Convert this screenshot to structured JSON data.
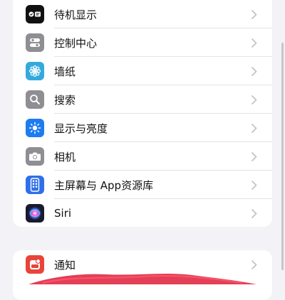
{
  "groups": [
    {
      "items": [
        {
          "label": "待机显示",
          "icon": "standby-icon",
          "color": "#111111"
        },
        {
          "label": "控制中心",
          "icon": "control-center-icon",
          "color": "#8e8e93"
        },
        {
          "label": "墙纸",
          "icon": "wallpaper-flower-icon",
          "color": "#34aadc"
        },
        {
          "label": "搜索",
          "icon": "search-icon",
          "color": "#8e8e93"
        },
        {
          "label": "显示与亮度",
          "icon": "brightness-icon",
          "color": "#1e7cf2"
        },
        {
          "label": "相机",
          "icon": "camera-icon",
          "color": "#8e8e93"
        },
        {
          "label": "主屏幕与 App资源库",
          "icon": "home-screen-icon",
          "color": "#2f6fe8"
        },
        {
          "label": "Siri",
          "icon": "siri-icon",
          "color": "#1a1a2e"
        }
      ]
    },
    {
      "items": [
        {
          "label": "通知",
          "icon": "notifications-icon",
          "color": "#e8443a"
        }
      ]
    }
  ]
}
